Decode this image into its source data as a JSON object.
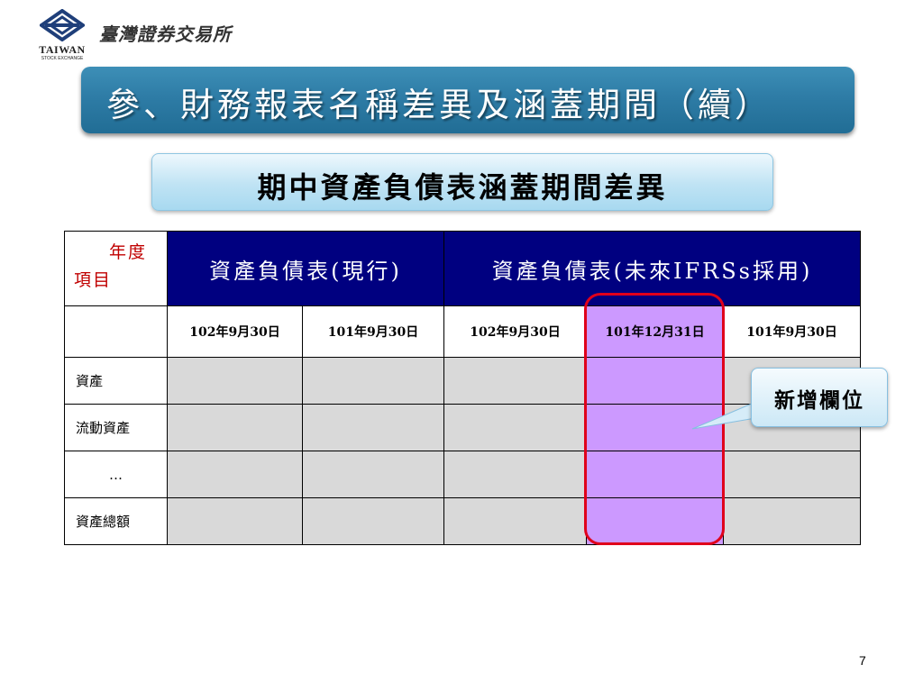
{
  "logo": {
    "en": "TAIWAN",
    "en_sub": "STOCK EXCHANGE",
    "cn": "臺灣證券交易所"
  },
  "title": "參、財務報表名稱差異及涵蓋期間（續）",
  "subtitle": "期中資產負債表涵蓋期間差異",
  "table": {
    "corner_year": "年度",
    "corner_item": "項目",
    "group_current": "資產負債表(現行)",
    "group_ifrs": "資產負債表(未來IFRSs採用)",
    "dates": [
      "102年9月30日",
      "101年9月30日",
      "102年9月30日",
      "101年12月31日",
      "101年9月30日"
    ],
    "highlight_column": 3,
    "rows": [
      "資產",
      "流動資產",
      "…",
      "資產總額"
    ]
  },
  "callout": "新增欄位",
  "page_number": "7",
  "colors": {
    "title_bar": "#2e7ca6",
    "header_navy": "#000080",
    "cell_gray": "#d9d9d9",
    "highlight_purple": "#cc99ff",
    "highlight_border": "#e0001b",
    "corner_text": "#c00000"
  }
}
